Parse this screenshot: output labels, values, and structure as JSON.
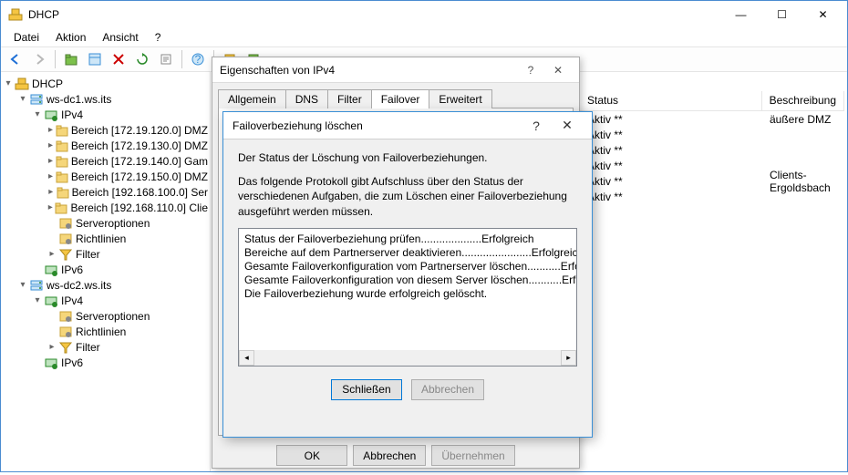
{
  "window": {
    "title": "DHCP",
    "menus": [
      "Datei",
      "Aktion",
      "Ansicht",
      "?"
    ]
  },
  "toolbar_icons": [
    "back",
    "forward",
    "up",
    "props",
    "delete",
    "refresh",
    "export",
    "help",
    "play",
    "stop"
  ],
  "tree": [
    {
      "indent": 0,
      "caret": "open",
      "icon": "dhcp",
      "label": "DHCP"
    },
    {
      "indent": 1,
      "caret": "open",
      "icon": "server",
      "label": "ws-dc1.ws.its"
    },
    {
      "indent": 2,
      "caret": "open",
      "icon": "ipv",
      "label": "IPv4"
    },
    {
      "indent": 3,
      "caret": "closed",
      "icon": "scope",
      "label": "Bereich [172.19.120.0] DMZ"
    },
    {
      "indent": 3,
      "caret": "closed",
      "icon": "scope",
      "label": "Bereich [172.19.130.0] DMZ"
    },
    {
      "indent": 3,
      "caret": "closed",
      "icon": "scope",
      "label": "Bereich [172.19.140.0] Gam"
    },
    {
      "indent": 3,
      "caret": "closed",
      "icon": "scope",
      "label": "Bereich [172.19.150.0] DMZ"
    },
    {
      "indent": 3,
      "caret": "closed",
      "icon": "scope",
      "label": "Bereich [192.168.100.0] Ser"
    },
    {
      "indent": 3,
      "caret": "closed",
      "icon": "scope",
      "label": "Bereich [192.168.110.0] Clie"
    },
    {
      "indent": 3,
      "caret": "none",
      "icon": "opt",
      "label": "Serveroptionen"
    },
    {
      "indent": 3,
      "caret": "none",
      "icon": "opt",
      "label": "Richtlinien"
    },
    {
      "indent": 3,
      "caret": "closed",
      "icon": "filter",
      "label": "Filter"
    },
    {
      "indent": 2,
      "caret": "none",
      "icon": "ipv",
      "label": "IPv6"
    },
    {
      "indent": 1,
      "caret": "open",
      "icon": "server",
      "label": "ws-dc2.ws.its"
    },
    {
      "indent": 2,
      "caret": "open",
      "icon": "ipv",
      "label": "IPv4"
    },
    {
      "indent": 3,
      "caret": "none",
      "icon": "opt",
      "label": "Serveroptionen"
    },
    {
      "indent": 3,
      "caret": "none",
      "icon": "opt",
      "label": "Richtlinien"
    },
    {
      "indent": 3,
      "caret": "closed",
      "icon": "filter",
      "label": "Filter"
    },
    {
      "indent": 2,
      "caret": "none",
      "icon": "ipv",
      "label": "IPv6"
    }
  ],
  "list": {
    "headers": {
      "status": "Status",
      "desc": "Beschreibung"
    },
    "rows": [
      {
        "status": "Aktiv **",
        "desc": "äußere DMZ"
      },
      {
        "status": "Aktiv **",
        "desc": ""
      },
      {
        "status": "Aktiv **",
        "desc": ""
      },
      {
        "status": "Aktiv **",
        "desc": ""
      },
      {
        "status": "Aktiv **",
        "desc": "Clients-Ergoldsbach"
      },
      {
        "status": "Aktiv **",
        "desc": ""
      }
    ]
  },
  "prop_dialog": {
    "title": "Eigenschaften von IPv4",
    "tabs": [
      "Allgemein",
      "DNS",
      "Filter",
      "Failover",
      "Erweitert"
    ],
    "active_tab": 3,
    "buttons": {
      "ok": "OK",
      "cancel": "Abbrechen",
      "apply": "Übernehmen"
    }
  },
  "del_dialog": {
    "title": "Failoverbeziehung löschen",
    "line1": "Der Status der Löschung von Failoverbeziehungen.",
    "line2": "Das folgende Protokoll gibt Aufschluss über den Status der verschiedenen Aufgaben, die zum Löschen einer Failoverbeziehung ausgeführt werden müssen.",
    "log": [
      "Status der Failoverbeziehung prüfen....................Erfolgreich",
      "Bereiche auf dem Partnerserver deaktivieren.......................Erfolgreich",
      "Gesamte Failoverkonfiguration vom Partnerserver löschen...........Erfolgreic",
      "Gesamte Failoverkonfiguration von diesem Server löschen...........Erfolgreic",
      "Die Failoverbeziehung wurde erfolgreich gelöscht."
    ],
    "buttons": {
      "close": "Schließen",
      "cancel": "Abbrechen"
    }
  }
}
